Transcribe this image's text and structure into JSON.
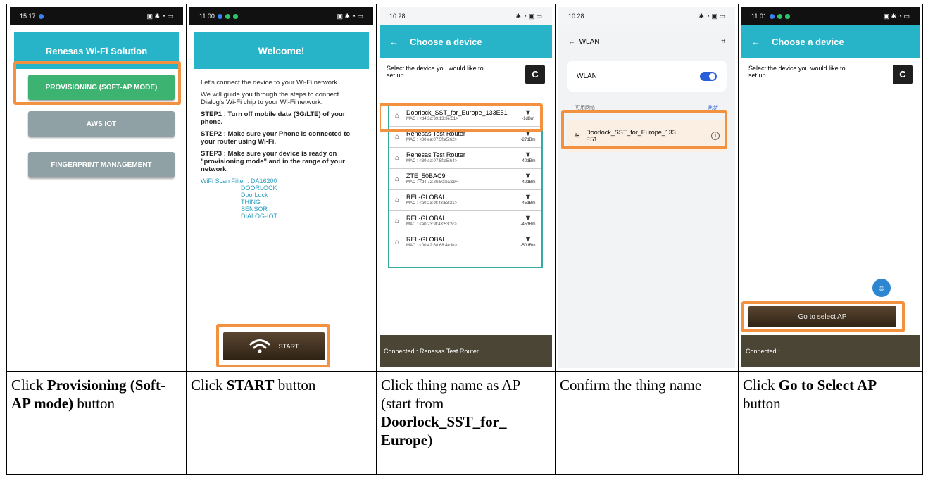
{
  "panels": [
    {
      "status_time": "15:17",
      "header": "Renesas Wi-Fi Solution",
      "buttons": [
        "PROVISIONING (SOFT-AP MODE)",
        "AWS IOT",
        "FINGERPRINT MANAGEMENT"
      ]
    },
    {
      "status_time": "11:00",
      "header": "Welcome!",
      "intro": "Let's connect the device to your Wi-Fi network",
      "guide": "We will guide you through the steps to connect Dialog's Wi-Fi chip to your Wi-Fi network.",
      "step1": "STEP1 : Turn off mobile data (3G/LTE) of your phone.",
      "step2": "STEP2 : Make sure your Phone is connected to your router using Wi-Fi.",
      "step3": "STEP3 : Make sure your device is ready on \"provisioning mode\" and in the range of your network",
      "filter_label": "WiFi Scan Filter : DA16200",
      "filter_items": [
        "DOORLOCK",
        "DoorLock",
        "THING",
        "SENSOR",
        "DIALOG-IOT"
      ],
      "start_label": "START"
    },
    {
      "status_time": "10:28",
      "header": "Choose a device",
      "instruction": "Select the device you would like to set up",
      "refresh_label": "C",
      "devices": [
        {
          "name": "Doorlock_SST_for_Europe_133E51",
          "mac": "MAC : <d4:3d:39:13:3e:51>",
          "signal": "-1dBm"
        },
        {
          "name": "Renesas Test Router",
          "mac": "MAC : <80:ea:07:5f:a5:62>",
          "signal": "-27dBm"
        },
        {
          "name": "Renesas Test Router",
          "mac": "MAC : <80:ea:07:5f:a5:64>",
          "signal": "-40dBm"
        },
        {
          "name": "ZTE_50BAC9",
          "mac": "MAC : <d4:72:26:50:ba:c9>",
          "signal": "-42dBm"
        },
        {
          "name": "REL-GLOBAL",
          "mac": "MAC : <a0:23:9f:43:53:21>",
          "signal": "-45dBm"
        },
        {
          "name": "REL-GLOBAL",
          "mac": "MAC : <a0:23:9f:43:53:2c>",
          "signal": "-45dBm"
        },
        {
          "name": "REL-GLOBAL",
          "mac": "MAC : <00:42:68:68:4e:fe>",
          "signal": "-50dBm"
        }
      ],
      "footer": "Connected :  Renesas Test Router"
    },
    {
      "status_time": "10:28",
      "header": "WLAN",
      "wlan_label": "WLAN",
      "available_label": "可用网络",
      "refresh_label": "刷新",
      "network_name": "Doorlock_SST_for_Europe_133E51"
    },
    {
      "status_time": "11:01",
      "header": "Choose a device",
      "instruction": "Select the device you would like to set up",
      "refresh_label": "C",
      "go_label": "Go to select AP",
      "footer": "Connected :"
    }
  ],
  "captions": [
    {
      "pre": "Click ",
      "bold": "Provisioning (Soft-AP mode)",
      "post": " button"
    },
    {
      "pre": "Click ",
      "bold": "START",
      "post": " button"
    },
    {
      "pre": "Click thing name as AP (start from ",
      "bold": "Doorlock_SST_for_ Europe",
      "post": ")"
    },
    {
      "pre": "Confirm the thing name",
      "bold": "",
      "post": ""
    },
    {
      "pre": "Click ",
      "bold": "Go to Select AP",
      "post": " button"
    }
  ],
  "colors": {
    "highlight": "#f2913f",
    "header_teal": "#27b3c8",
    "provision_green": "#3cb371",
    "button_gray": "#8fa1a5",
    "footer_brown": "#4b4535",
    "toggle_blue": "#2b5fd9"
  }
}
